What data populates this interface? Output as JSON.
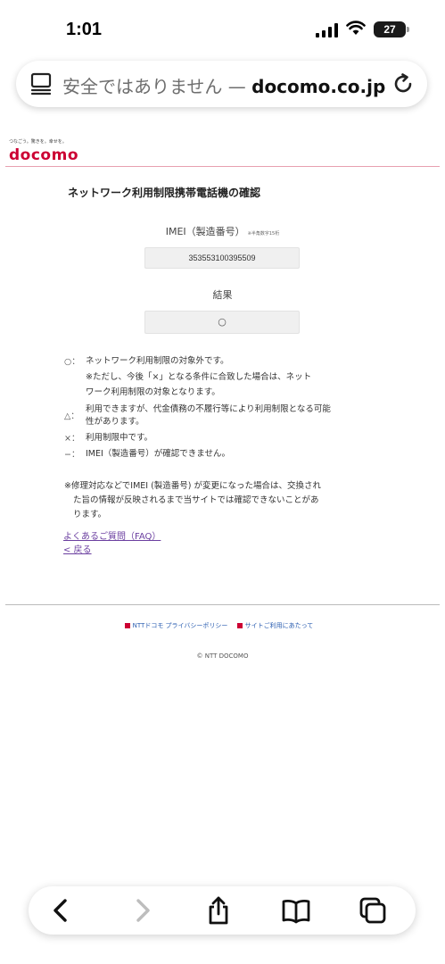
{
  "status_bar": {
    "time": "1:01",
    "battery": "27"
  },
  "url_bar": {
    "insecure_label": "安全ではありません — ",
    "domain": "docomo.co.jp"
  },
  "brand": {
    "tagline": "つなごう。驚きを。幸せを。",
    "logo": "docomo",
    "color": "#cc0033"
  },
  "page": {
    "title": "ネットワーク利用制限携帯電話機の確認",
    "imei_label": "IMEI（製造番号）",
    "imei_note": "※半角数字15桁",
    "imei_value": "353553100395509",
    "result_label": "結果",
    "result_value": "○"
  },
  "legend": [
    {
      "symbol": "○：",
      "lines": [
        "ネットワーク利用制限の対象外です。"
      ]
    },
    {
      "symbol": "",
      "lines": [
        "※ただし、今後「×」となる条件に合致した場合は、ネット",
        "ワーク利用制限の対象となります。"
      ]
    },
    {
      "symbol": "△：",
      "lines": [
        "利用できますが、代金債務の不履行等により利用制限となる可能",
        "性があります。"
      ]
    },
    {
      "symbol": "×：",
      "lines": [
        "利用制限中です。"
      ]
    },
    {
      "symbol": "−：",
      "lines": [
        "IMEI（製造番号）が確認できません。"
      ]
    }
  ],
  "note": {
    "lines": [
      "※修理対応などでIMEI (製造番号) が変更になった場合は、交換され",
      "た旨の情報が反映されるまで当サイトでは確認できないことがあ",
      "ります。"
    ]
  },
  "links": {
    "faq": "よくあるご質問（FAQ）",
    "back": "< 戻る"
  },
  "footer": {
    "privacy": "NTTドコモ プライバシーポリシー",
    "terms": "サイトご利用にあたって",
    "copyright": "© NTT DOCOMO"
  },
  "toolbar": {
    "back_icon": "chevron-left-icon",
    "forward_icon": "chevron-right-icon",
    "share_icon": "share-icon",
    "bookmarks_icon": "book-icon",
    "tabs_icon": "tabs-icon"
  }
}
